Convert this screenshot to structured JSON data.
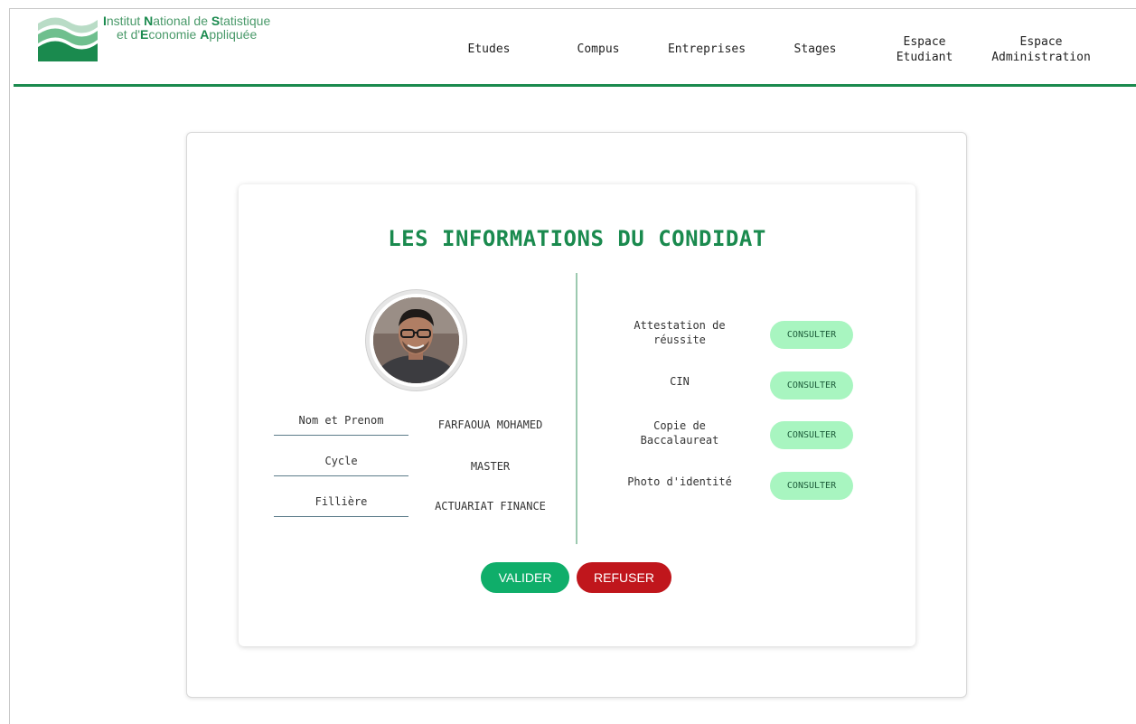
{
  "logo": {
    "line1_parts": [
      "I",
      "nstitut ",
      "N",
      "ational de ",
      "S",
      "tatistique"
    ],
    "line2_parts": [
      "et d'",
      "E",
      "conomie ",
      "A",
      "ppliquée"
    ],
    "colors": {
      "accent": "#1a8a4e",
      "light": "#4a9a6a"
    }
  },
  "nav": {
    "items": [
      {
        "label": "Etudes"
      },
      {
        "label": "Compus"
      },
      {
        "label": "Entreprises"
      },
      {
        "label": "Stages"
      },
      {
        "label_line1": "Espace",
        "label_line2": "Etudiant"
      },
      {
        "label_line1": "Espace",
        "label_line2": "Administration"
      }
    ]
  },
  "main": {
    "title": "LES INFORMATIONS DU CONDIDAT",
    "candidate": {
      "fields": [
        {
          "label": "Nom et Prenom",
          "value": "FARFAOUA MOHAMED"
        },
        {
          "label": "Cycle",
          "value": "MASTER"
        },
        {
          "label": "Fillière",
          "value": "ACTUARIAT FINANCE"
        }
      ]
    },
    "documents": [
      {
        "label_line1": "Attestation de",
        "label_line2": "réussite",
        "button": "CONSULTER"
      },
      {
        "label_line1": "CIN",
        "label_line2": "",
        "button": "CONSULTER"
      },
      {
        "label_line1": "Copie de",
        "label_line2": "Baccalaureat",
        "button": "CONSULTER"
      },
      {
        "label_line1": "Photo d'identité",
        "label_line2": "",
        "button": "CONSULTER"
      }
    ],
    "actions": {
      "validate": "VALIDER",
      "refuse": "REFUSER"
    }
  },
  "colors": {
    "brand_green": "#1a8a4e",
    "validate": "#0fae6a",
    "refuse": "#c0161c",
    "consult_bg": "#a8f5c0"
  }
}
